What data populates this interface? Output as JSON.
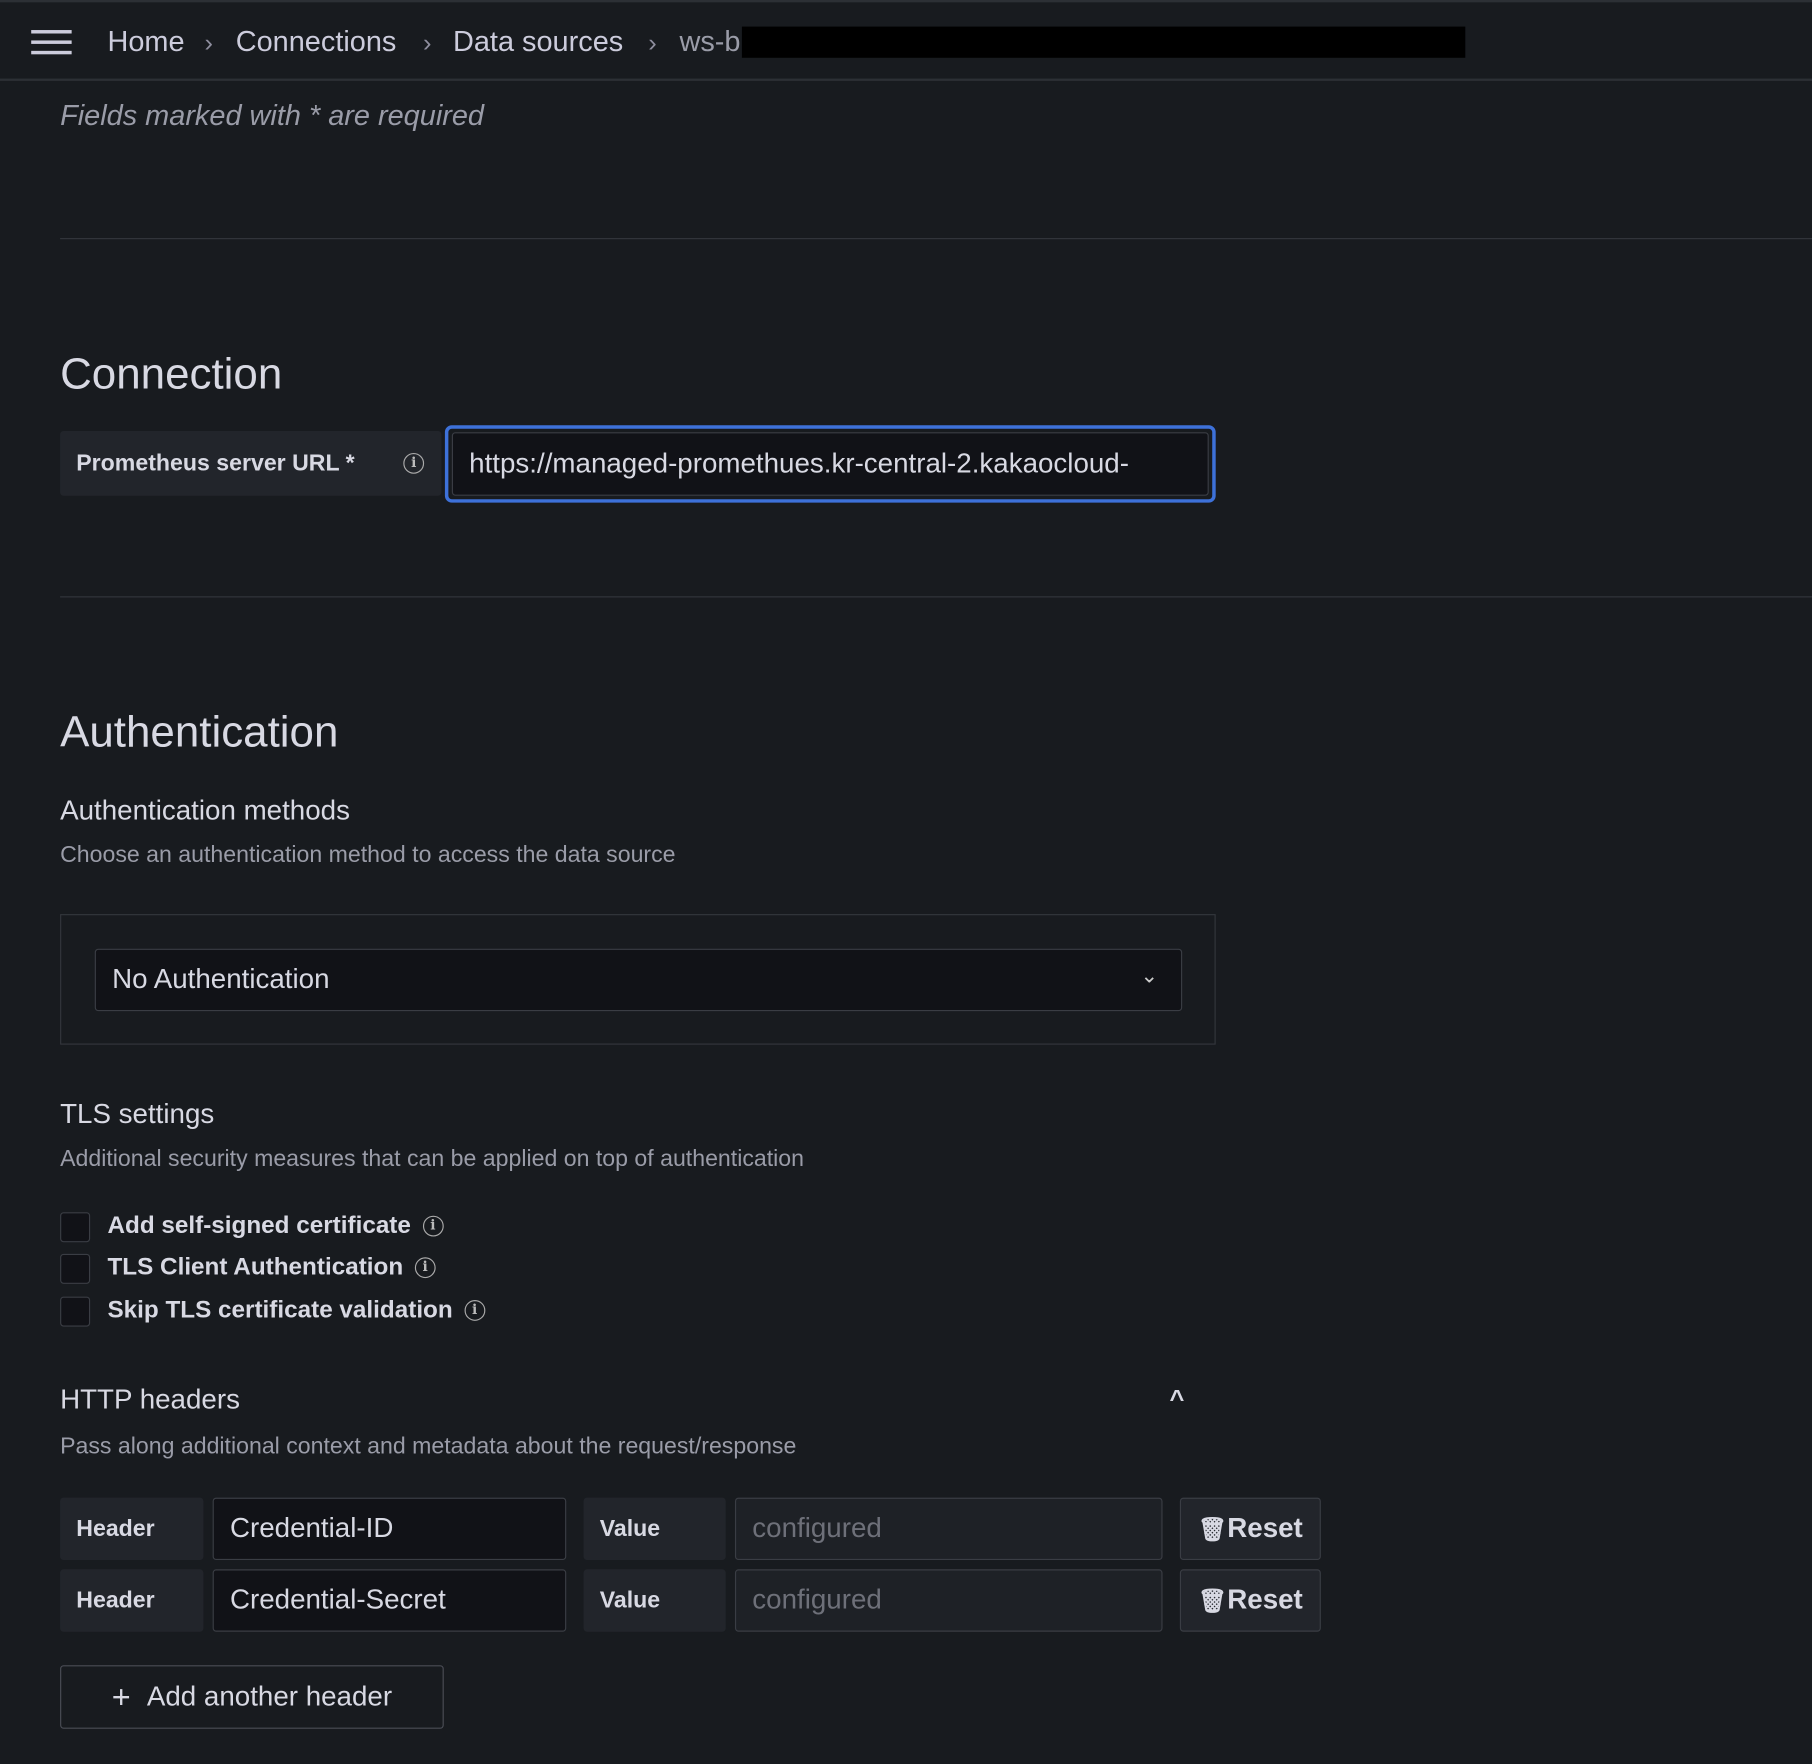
{
  "breadcrumb": {
    "items": [
      "Home",
      "Connections",
      "Data sources",
      "ws-b"
    ]
  },
  "required_note": "Fields marked with * are required",
  "connection": {
    "title": "Connection",
    "url_label": "Prometheus server URL *",
    "url_value": "https://managed-promethues.kr-central-2.kakaocloud-"
  },
  "authentication": {
    "title": "Authentication",
    "methods_title": "Authentication methods",
    "methods_desc": "Choose an authentication method to access the data source",
    "selected": "No Authentication"
  },
  "tls": {
    "title": "TLS settings",
    "desc": "Additional security measures that can be applied on top of authentication",
    "options": [
      {
        "label": "Add self-signed certificate",
        "checked": false
      },
      {
        "label": "TLS Client Authentication",
        "checked": false
      },
      {
        "label": "Skip TLS certificate validation",
        "checked": false
      }
    ]
  },
  "http_headers": {
    "title": "HTTP headers",
    "desc": "Pass along additional context and metadata about the request/response",
    "header_label": "Header",
    "value_label": "Value",
    "reset_label": "Reset",
    "rows": [
      {
        "header": "Credential-ID",
        "value_placeholder": "configured"
      },
      {
        "header": "Credential-Secret",
        "value_placeholder": "configured"
      }
    ],
    "add_label": "Add another header"
  },
  "colors": {
    "background": "#181b1f",
    "focus": "#3d71d9",
    "input": "#111217"
  }
}
